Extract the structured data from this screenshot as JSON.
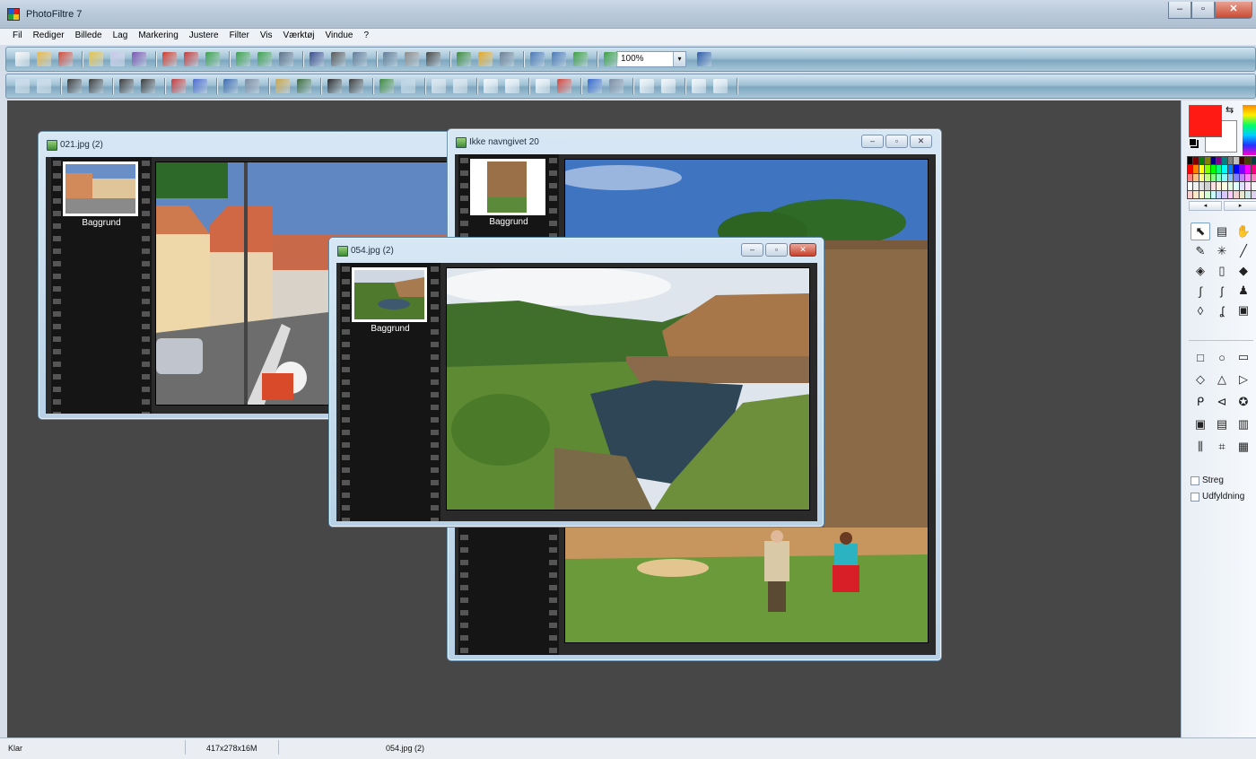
{
  "app": {
    "title": "PhotoFiltre 7"
  },
  "window_controls": {
    "minimize": "–",
    "maximize": "▫",
    "close": "✕"
  },
  "menu": [
    "Fil",
    "Rediger",
    "Billede",
    "Lag",
    "Markering",
    "Justere",
    "Filter",
    "Vis",
    "Værktøj",
    "Vindue",
    "?"
  ],
  "toolbar": {
    "zoom_value": "100%",
    "row1_colors": [
      "#f5f5f5",
      "#e8b84a",
      "#d24a3a",
      "#e2c24a",
      "#c8c8e8",
      "#7a55b0",
      "#d33a2a",
      "#c43a3a",
      "#3aa04a",
      "#3aa04a",
      "#3aa04a",
      "#5a6f86",
      "#3a4a8a",
      "#555555",
      "#607a96",
      "#607a96",
      "#8a8a8a",
      "#444444",
      "#3a8a3a",
      "#e2a824",
      "#6b7e93",
      "#4a78b6",
      "#4a78b6",
      "#3aa040",
      "#3aa040",
      "#2b5aa8"
    ],
    "row2_colors": [
      "#c9dbea",
      "#c9dbea",
      "#3a3a3a",
      "#3a3a3a",
      "#3a3a3a",
      "#3a3a3a",
      "#c43a3a",
      "#4a6ad0",
      "#3a6ab0",
      "#7a8aa0",
      "#c8a44a",
      "#3a6a3a",
      "#2a2a2a",
      "#3a3a3a",
      "#3a8a3a",
      "#bcd4e6",
      "#dbe6ef",
      "#dbe6ef",
      "#f1f6fa",
      "#f1f6fa",
      "#f1f6fa",
      "#d4443a",
      "#3366cc",
      "#7a8aa0",
      "#f1f6fa",
      "#f1f6fa",
      "#f1f6fa",
      "#f1f6fa"
    ]
  },
  "windows": [
    {
      "title": "021.jpg (2)",
      "layer_label": "Baggrund"
    },
    {
      "title": "Ikke navngivet 20",
      "layer_label": "Baggrund"
    },
    {
      "title": "054.jpg (2)",
      "layer_label": "Baggrund"
    }
  ],
  "palette": {
    "foreground_color": "#ff1a14",
    "background_color": "#ffffff",
    "swatches": [
      "#000000",
      "#800000",
      "#008000",
      "#808000",
      "#000080",
      "#800080",
      "#008080",
      "#808080",
      "#c0c0c0",
      "#400000",
      "#404000",
      "#004040",
      "#ff0000",
      "#ff8000",
      "#ffff00",
      "#80ff00",
      "#00ff00",
      "#00ff80",
      "#00ffff",
      "#0080ff",
      "#0000ff",
      "#8000ff",
      "#ff00ff",
      "#ff0080",
      "#ff8080",
      "#ffc080",
      "#ffff80",
      "#c0ff80",
      "#80ff80",
      "#80ffc0",
      "#80ffff",
      "#80c0ff",
      "#8080ff",
      "#c080ff",
      "#ff80ff",
      "#ff80c0",
      "#ffffff",
      "#f0f0f0",
      "#e0e0e0",
      "#d0d0d0",
      "#ffe0e0",
      "#fff0e0",
      "#ffffe0",
      "#e0ffe0",
      "#e0ffff",
      "#e0e0ff",
      "#ffe0ff",
      "#f8f8f8",
      "#ffd0d0",
      "#ffe8c8",
      "#ffffc8",
      "#d0ffd0",
      "#c8ffff",
      "#c8d8ff",
      "#d8c8ff",
      "#ffc8ff",
      "#f0d0d0",
      "#e8e8d0",
      "#d0e8e8",
      "#e0d0f0"
    ],
    "tool_icons": [
      "pointer-icon",
      "select-layer-icon",
      "hand-icon",
      "eyedropper-icon",
      "magic-wand-icon",
      "line-icon",
      "fill-bucket-icon",
      "spray-icon",
      "eraser-icon",
      "brush-icon",
      "advanced-brush-icon",
      "stamp-icon",
      "blur-icon",
      "smudge-icon",
      "clone-icon"
    ],
    "tool_glyphs": [
      "⬉",
      "▤",
      "✋",
      "✎",
      "✳",
      "╱",
      "◈",
      "▯",
      "◆",
      "∫",
      "ʃ",
      "♟",
      "◊",
      "ʆ",
      "▣"
    ],
    "shape_icons": [
      "rectangle-icon",
      "ellipse-icon",
      "rounded-rect-icon",
      "diamond-icon",
      "triangle-icon",
      "play-icon",
      "lasso-icon",
      "polygon-icon",
      "open-icon",
      "select-all-icon",
      "invert-icon",
      "crop-icon",
      "fit-width-icon",
      "fit-both-icon",
      "fit-window-icon"
    ],
    "shape_glyphs": [
      "□",
      "○",
      "▭",
      "◇",
      "△",
      "▷",
      "ᑭ",
      "⊲",
      "✪",
      "▣",
      "▤",
      "▥",
      "⫼",
      "⌗",
      "▦"
    ],
    "stroke_label": "Streg",
    "fill_label": "Udfyldning"
  },
  "status": {
    "message": "Klar",
    "dimensions": "417x278x16M",
    "filename": "054.jpg (2)"
  }
}
